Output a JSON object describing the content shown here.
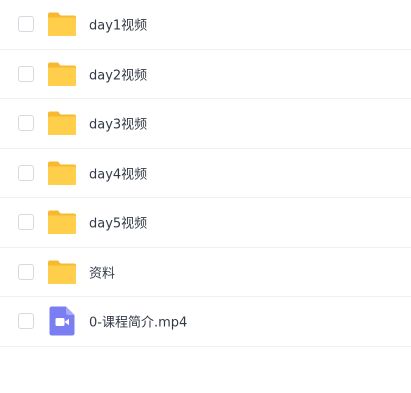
{
  "files": [
    {
      "name": "day1视频",
      "type": "folder"
    },
    {
      "name": "day2视频",
      "type": "folder"
    },
    {
      "name": "day3视频",
      "type": "folder"
    },
    {
      "name": "day4视频",
      "type": "folder"
    },
    {
      "name": "day5视频",
      "type": "folder"
    },
    {
      "name": "资料",
      "type": "folder"
    },
    {
      "name": "0-课程简介.mp4",
      "type": "video"
    }
  ],
  "colors": {
    "folder": "#ffcf4b",
    "folder_tab": "#f7b931",
    "video_icon": "#7b7df2"
  }
}
